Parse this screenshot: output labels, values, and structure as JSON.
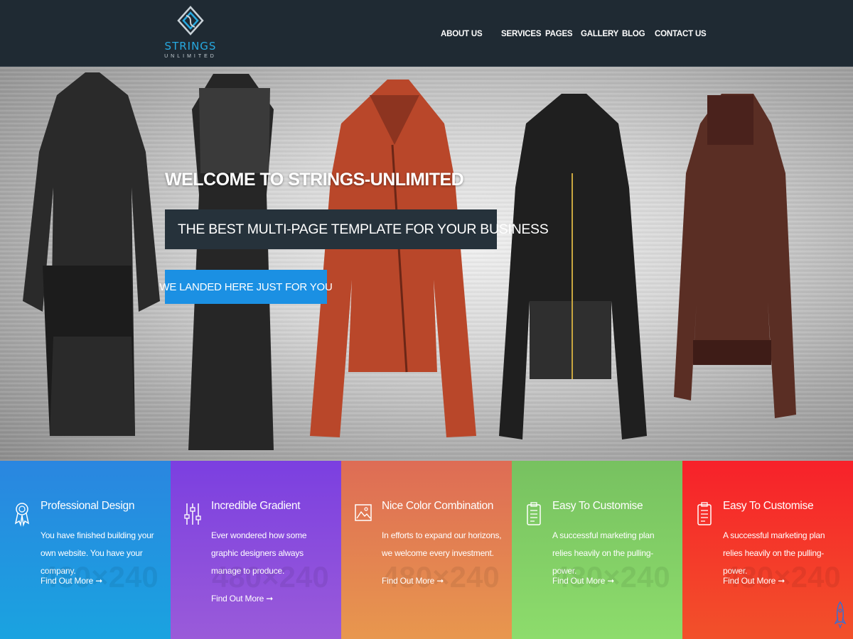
{
  "brand": {
    "name": "STRINGS",
    "sub": "UNLIMITED",
    "accent": "#27a9e1"
  },
  "nav": [
    {
      "label": "ABOUT US"
    },
    {
      "label": "SERVICES"
    },
    {
      "label": "PAGES"
    },
    {
      "label": "GALLERY"
    },
    {
      "label": "BLOG"
    },
    {
      "label": "CONTACT US"
    }
  ],
  "hero": {
    "title": "WELCOME TO STRINGS-UNLIMITED",
    "subtitle": "THE BEST MULTI-PAGE TEMPLATE FOR YOUR BUSINESS",
    "cta": "WE LANDED HERE JUST FOR YOU",
    "image": "hanging-leather-jackets"
  },
  "features": [
    {
      "title": "Professional Design",
      "text": "You have finished building your own website. You have your company.",
      "link": "Find Out More",
      "watermark": "480×240",
      "icon": "award-icon",
      "color_from": "#2a86e0",
      "color_to": "#1aa3e0"
    },
    {
      "title": "Incredible Gradient",
      "text": "Ever wondered how some graphic designers always manage to produce.",
      "link": "Find Out More",
      "watermark": "480×240",
      "icon": "sliders-icon",
      "color_from": "#7b3fe0",
      "color_to": "#9a5bd9"
    },
    {
      "title": "Nice Color Combination",
      "text": "In efforts to expand our horizons, we welcome every investment.",
      "link": "Find Out More",
      "watermark": "480×240",
      "icon": "image-icon",
      "color_from": "#de6c55",
      "color_to": "#e8974e"
    },
    {
      "title": "Easy To Customise",
      "text": "A successful marketing plan relies heavily on the pulling-power.",
      "link": "Find Out More",
      "watermark": "480×240",
      "icon": "clipboard-icon",
      "color_from": "#77c160",
      "color_to": "#8ddc6c"
    },
    {
      "title": "Easy To Customise",
      "text": "A successful marketing plan relies heavily on the pulling-power.",
      "link": "Find Out More",
      "watermark": "480×240",
      "icon": "clipboard-icon",
      "color_from": "#f7212a",
      "color_to": "#f2512a"
    }
  ],
  "scroll_top_icon": "rocket-icon"
}
